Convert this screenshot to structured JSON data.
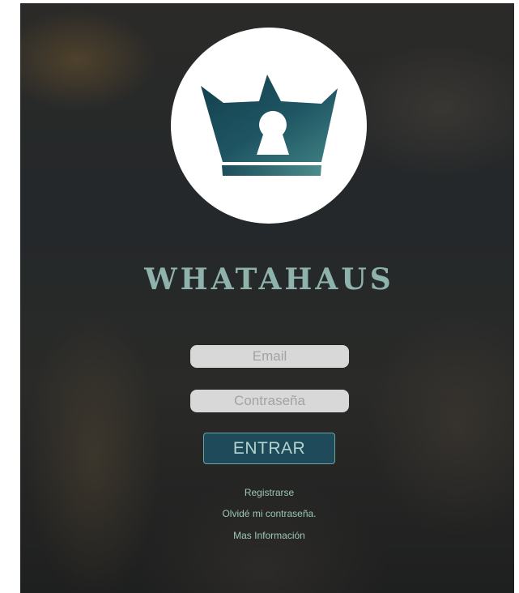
{
  "app": {
    "brand_name": "WHATAHAUS",
    "logo_icon": "crown-keyhole-icon",
    "colors": {
      "brand_text": "#8fb3ac",
      "logo_teal": "#1f4d57",
      "button_bg": "#1e4a5a",
      "link_text": "#9cc7b8"
    }
  },
  "login_form": {
    "email_placeholder": "Email",
    "password_placeholder": "Contraseña",
    "submit_label": "ENTRAR"
  },
  "links": {
    "register": "Registrarse",
    "forgot_password": "Olvidé mi contraseña.",
    "more_info": "Mas Información"
  }
}
